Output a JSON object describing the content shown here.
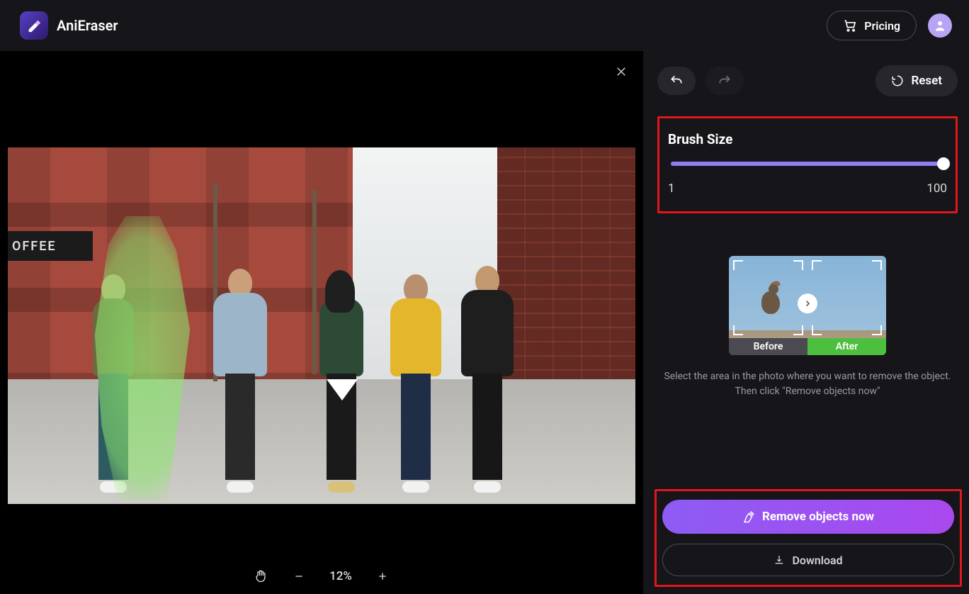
{
  "header": {
    "app_name": "AniEraser",
    "pricing_label": "Pricing"
  },
  "canvas": {
    "coffee_sign": "OFFEE",
    "zoom": {
      "value": "12%"
    }
  },
  "sidebar": {
    "reset_label": "Reset",
    "brush": {
      "title": "Brush Size",
      "min": "1",
      "max": "100"
    },
    "preview": {
      "before_label": "Before",
      "after_label": "After",
      "instruction": "Select the area in the photo where you want to remove the object. Then click \"Remove objects now\""
    },
    "actions": {
      "remove_label": "Remove objects now",
      "download_label": "Download"
    }
  }
}
